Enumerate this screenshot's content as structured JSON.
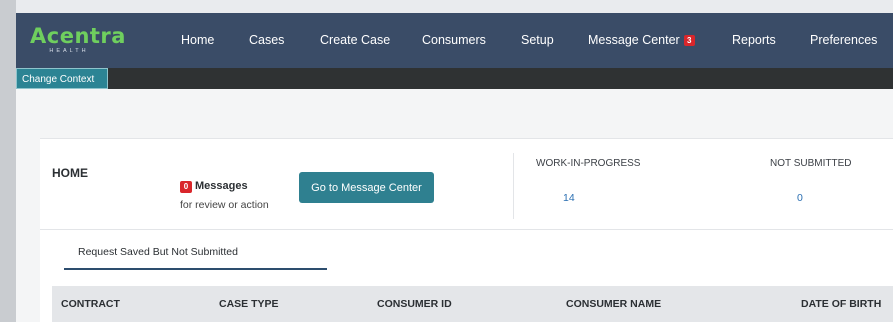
{
  "app": {
    "logo_text": "Acentra",
    "logo_subtext": "HEALTH"
  },
  "nav": {
    "items": [
      {
        "label": "Home"
      },
      {
        "label": "Cases"
      },
      {
        "label": "Create Case"
      },
      {
        "label": "Consumers"
      },
      {
        "label": "Setup"
      },
      {
        "label": "Message Center",
        "badge": "3"
      },
      {
        "label": "Reports"
      },
      {
        "label": "Preferences"
      }
    ]
  },
  "subbar": {
    "change_context_label": "Change Context"
  },
  "home": {
    "title": "HOME",
    "messages": {
      "count": "0",
      "label": "Messages",
      "subtext": "for review or action"
    },
    "go_button_label": "Go to Message Center",
    "stats": [
      {
        "label": "WORK-IN-PROGRESS",
        "value": "14"
      },
      {
        "label": "NOT SUBMITTED",
        "value": "0"
      }
    ],
    "tab_label": "Request Saved But Not Submitted",
    "table": {
      "columns": [
        "CONTRACT",
        "CASE TYPE",
        "CONSUMER ID",
        "CONSUMER NAME",
        "DATE OF BIRTH"
      ]
    }
  },
  "colors": {
    "navbar": "#3a4c67",
    "logo": "#6fcf5e",
    "accent_button": "#2f8090",
    "badge": "#d9262b",
    "link_value": "#2b6fb2"
  }
}
